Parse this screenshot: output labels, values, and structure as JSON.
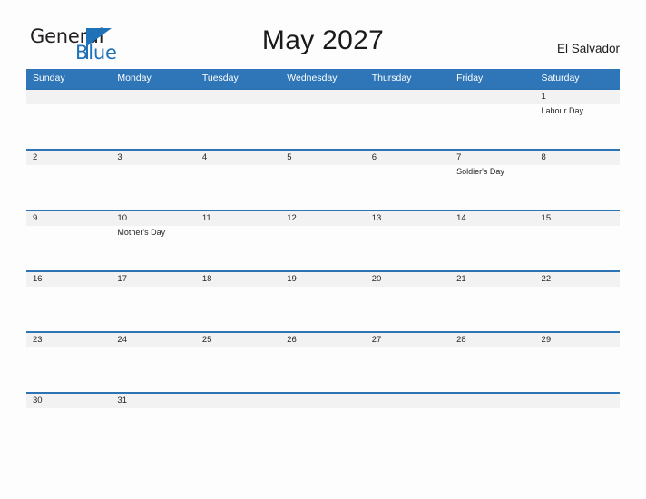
{
  "logo": {
    "word_one": "General",
    "word_two": "Blue",
    "triangle_icon": "triangle-logo-mark",
    "brand_color": "#1f72b8"
  },
  "header": {
    "title": "May 2027",
    "country": "El Salvador",
    "header_bar_color": "#2e76b8",
    "row_divider_color": "#2e74b5",
    "day_band_color": "#f2f2f2"
  },
  "weekdays": [
    "Sunday",
    "Monday",
    "Tuesday",
    "Wednesday",
    "Thursday",
    "Friday",
    "Saturday"
  ],
  "weeks": [
    {
      "days": [
        {
          "num": "",
          "event": ""
        },
        {
          "num": "",
          "event": ""
        },
        {
          "num": "",
          "event": ""
        },
        {
          "num": "",
          "event": ""
        },
        {
          "num": "",
          "event": ""
        },
        {
          "num": "",
          "event": ""
        },
        {
          "num": "1",
          "event": "Labour Day"
        }
      ]
    },
    {
      "days": [
        {
          "num": "2",
          "event": ""
        },
        {
          "num": "3",
          "event": ""
        },
        {
          "num": "4",
          "event": ""
        },
        {
          "num": "5",
          "event": ""
        },
        {
          "num": "6",
          "event": ""
        },
        {
          "num": "7",
          "event": "Soldier's Day"
        },
        {
          "num": "8",
          "event": ""
        }
      ]
    },
    {
      "days": [
        {
          "num": "9",
          "event": ""
        },
        {
          "num": "10",
          "event": "Mother's Day"
        },
        {
          "num": "11",
          "event": ""
        },
        {
          "num": "12",
          "event": ""
        },
        {
          "num": "13",
          "event": ""
        },
        {
          "num": "14",
          "event": ""
        },
        {
          "num": "15",
          "event": ""
        }
      ]
    },
    {
      "days": [
        {
          "num": "16",
          "event": ""
        },
        {
          "num": "17",
          "event": ""
        },
        {
          "num": "18",
          "event": ""
        },
        {
          "num": "19",
          "event": ""
        },
        {
          "num": "20",
          "event": ""
        },
        {
          "num": "21",
          "event": ""
        },
        {
          "num": "22",
          "event": ""
        }
      ]
    },
    {
      "days": [
        {
          "num": "23",
          "event": ""
        },
        {
          "num": "24",
          "event": ""
        },
        {
          "num": "25",
          "event": ""
        },
        {
          "num": "26",
          "event": ""
        },
        {
          "num": "27",
          "event": ""
        },
        {
          "num": "28",
          "event": ""
        },
        {
          "num": "29",
          "event": ""
        }
      ]
    },
    {
      "days": [
        {
          "num": "30",
          "event": ""
        },
        {
          "num": "31",
          "event": ""
        },
        {
          "num": "",
          "event": ""
        },
        {
          "num": "",
          "event": ""
        },
        {
          "num": "",
          "event": ""
        },
        {
          "num": "",
          "event": ""
        },
        {
          "num": "",
          "event": ""
        }
      ]
    }
  ]
}
